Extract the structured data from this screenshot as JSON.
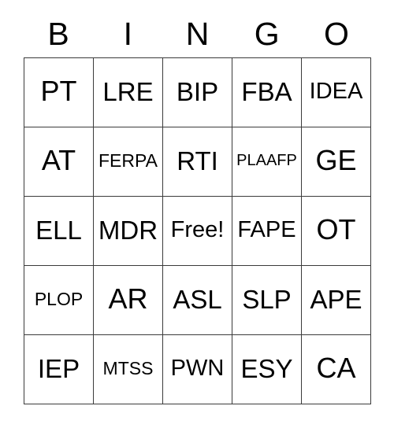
{
  "card": {
    "title_letters": [
      "B",
      "I",
      "N",
      "G",
      "O"
    ],
    "free_space_label": "Free!",
    "grid_line_color": "#3b3b3b",
    "text_color": "#000000",
    "background_color": "#ffffff",
    "columns": 5,
    "rows": 5
  },
  "rows": [
    {
      "cells": [
        {
          "label": "PT",
          "size": "size-xl"
        },
        {
          "label": "LRE",
          "size": "size-lg"
        },
        {
          "label": "BIP",
          "size": "size-lg"
        },
        {
          "label": "FBA",
          "size": "size-lg"
        },
        {
          "label": "IDEA",
          "size": "size-md"
        }
      ]
    },
    {
      "cells": [
        {
          "label": "AT",
          "size": "size-xl"
        },
        {
          "label": "FERPA",
          "size": "size-sm"
        },
        {
          "label": "RTI",
          "size": "size-lg"
        },
        {
          "label": "PLAAFP",
          "size": "size-xs"
        },
        {
          "label": "GE",
          "size": "size-xl"
        }
      ]
    },
    {
      "cells": [
        {
          "label": "ELL",
          "size": "size-lg"
        },
        {
          "label": "MDR",
          "size": "size-lg"
        },
        {
          "label": "Free!",
          "size": "size-md"
        },
        {
          "label": "FAPE",
          "size": "size-md"
        },
        {
          "label": "OT",
          "size": "size-xl"
        }
      ]
    },
    {
      "cells": [
        {
          "label": "PLOP",
          "size": "size-sm"
        },
        {
          "label": "AR",
          "size": "size-xl"
        },
        {
          "label": "ASL",
          "size": "size-lg"
        },
        {
          "label": "SLP",
          "size": "size-lg"
        },
        {
          "label": "APE",
          "size": "size-lg"
        }
      ]
    },
    {
      "cells": [
        {
          "label": "IEP",
          "size": "size-lg"
        },
        {
          "label": "MTSS",
          "size": "size-sm"
        },
        {
          "label": "PWN",
          "size": "size-md"
        },
        {
          "label": "ESY",
          "size": "size-lg"
        },
        {
          "label": "CA",
          "size": "size-xl"
        }
      ]
    }
  ]
}
